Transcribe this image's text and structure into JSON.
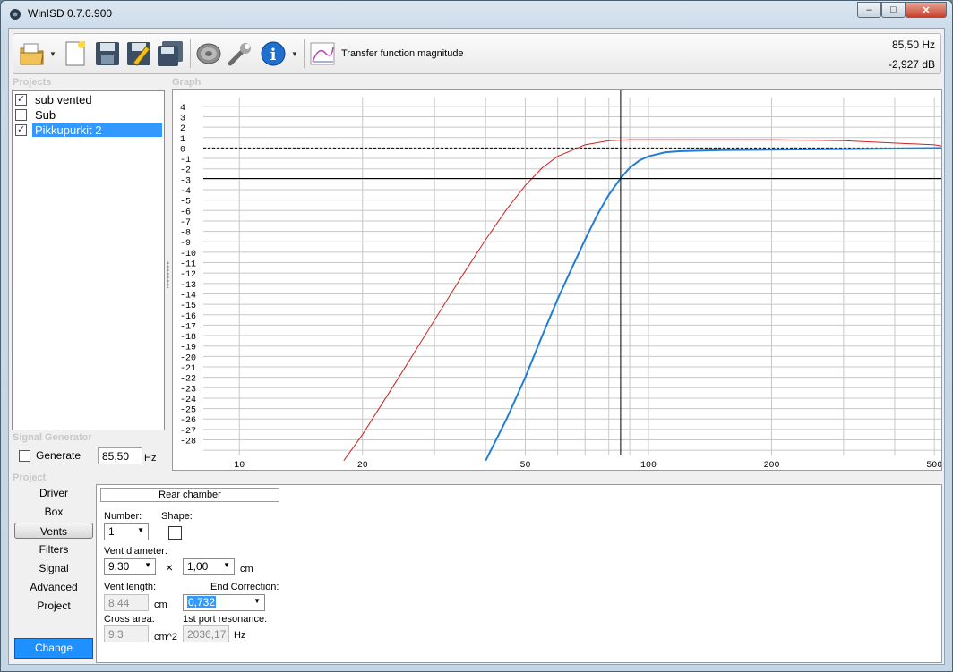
{
  "window": {
    "title": "WinISD 0.7.0.900",
    "minimize": "–",
    "maximize": "□",
    "close": "✕"
  },
  "toolbar": {
    "icons": [
      "open-folder-icon",
      "new-file-icon",
      "save-icon",
      "save-as-icon",
      "save-all-icon",
      "speaker-icon",
      "wrench-icon",
      "info-icon",
      "graph-icon"
    ],
    "graph_label": "Transfer function magnitude",
    "readout_freq": "85,50 Hz",
    "readout_db": "-2,927 dB"
  },
  "sections": {
    "projects": "Projects",
    "graph": "Graph",
    "signal_generator": "Signal Generator",
    "project": "Project"
  },
  "projects": [
    {
      "name": "sub vented",
      "checked": true,
      "selected": false
    },
    {
      "name": "Sub",
      "checked": false,
      "selected": false
    },
    {
      "name": "Pikkupurkit 2",
      "checked": true,
      "selected": true
    }
  ],
  "signal_generator": {
    "label": "Generate",
    "checked": false,
    "value": "85,50",
    "unit": "Hz"
  },
  "nav": {
    "items": [
      "Driver",
      "Box",
      "Vents",
      "Filters",
      "Signal",
      "Advanced",
      "Project"
    ],
    "active": "Vents",
    "change": "Change"
  },
  "vents": {
    "header": "Rear chamber",
    "number_label": "Number:",
    "number_value": "1",
    "shape_label": "Shape:",
    "diameter_label": "Vent diameter:",
    "diameter_value": "9,30",
    "times": "×",
    "diameter2_value": "1,00",
    "diameter_unit": "cm",
    "length_label": "Vent length:",
    "length_value": "8,44",
    "length_unit": "cm",
    "end_correction_label": "End Correction:",
    "end_correction_value": "0,732",
    "cross_area_label": "Cross area:",
    "cross_area_value": "9,3",
    "cross_area_unit": "cm^2",
    "port_resonance_label": "1st port resonance:",
    "port_resonance_value": "2036,17",
    "port_resonance_unit": "Hz"
  },
  "chart_data": {
    "type": "line",
    "xscale": "log",
    "xlim": [
      8.5,
      520
    ],
    "ylim": [
      -29.5,
      4.5
    ],
    "x_ticks": [
      10,
      20,
      50,
      100,
      200,
      500
    ],
    "y_ticks": [
      4,
      3,
      2,
      1,
      0,
      -1,
      -2,
      -3,
      -4,
      -5,
      -6,
      -7,
      -8,
      -9,
      -10,
      -11,
      -12,
      -13,
      -14,
      -15,
      -16,
      -17,
      -18,
      -19,
      -20,
      -21,
      -22,
      -23,
      -24,
      -25,
      -26,
      -27,
      -28
    ],
    "grid": true,
    "cursor": {
      "x": 85.5,
      "y": -2.927
    },
    "reference_lines": [
      0,
      -2.927
    ],
    "series": [
      {
        "color": "#cc2222",
        "x": [
          18,
          20,
          25,
          30,
          35,
          40,
          45,
          50,
          55,
          60,
          70,
          80,
          90,
          100,
          150,
          200,
          300,
          500,
          520
        ],
        "y": [
          -30,
          -27.5,
          -21.5,
          -16.5,
          -12.3,
          -8.8,
          -5.9,
          -3.6,
          -1.9,
          -0.8,
          0.3,
          0.7,
          0.8,
          0.8,
          0.8,
          0.8,
          0.7,
          0.3,
          0.2
        ]
      },
      {
        "color": "#1f7fd8",
        "x": [
          40,
          45,
          50,
          55,
          60,
          65,
          70,
          75,
          80,
          85.5,
          90,
          95,
          100,
          110,
          120,
          150,
          200,
          300,
          520
        ],
        "y": [
          -30,
          -26,
          -22,
          -18,
          -14.5,
          -11.5,
          -8.8,
          -6.4,
          -4.5,
          -2.9,
          -1.9,
          -1.2,
          -0.8,
          -0.4,
          -0.3,
          -0.2,
          -0.15,
          -0.1,
          0
        ]
      }
    ]
  }
}
